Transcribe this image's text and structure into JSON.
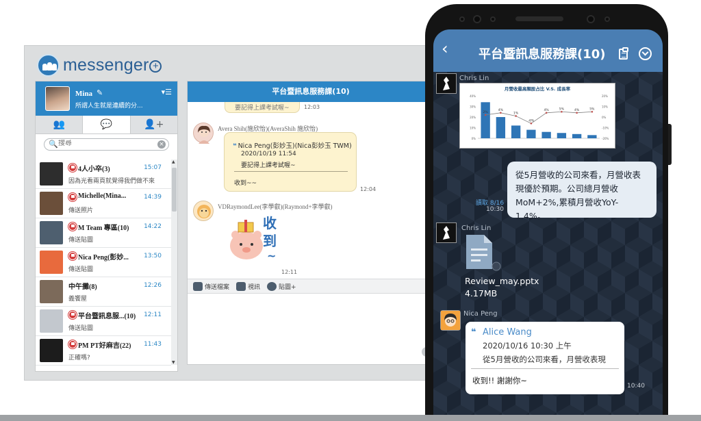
{
  "app": {
    "logo_text": "messenger",
    "logo_plus": "+"
  },
  "colors": {
    "brand_blue": "#2c86c6",
    "phone_header": "#4a7eb3",
    "bubble_yellow": "#fdf3cf",
    "unread_red": "#d33b3b"
  },
  "sidebar": {
    "profile": {
      "name": "Mina",
      "status": "所謂人生就是連續的分..."
    },
    "tabs": [
      {
        "icon": "contacts-icon"
      },
      {
        "icon": "chat-icon"
      },
      {
        "icon": "add-contact-icon"
      }
    ],
    "search": {
      "placeholder": "搜尋"
    },
    "conversations": [
      {
        "title": "4人小卒(3)",
        "time": "15:07",
        "preview": "因為光看兩頁就覺得我們做不來",
        "flag": true
      },
      {
        "title": "Michelle(Mina...",
        "time": "14:39",
        "preview": "傳送照片",
        "flag": true
      },
      {
        "title": "M Team 專區(10)",
        "time": "14:22",
        "preview": "傳送貼圖",
        "flag": true
      },
      {
        "title": "Nica Peng(彭妙...",
        "time": "13:50",
        "preview": "傳送貼圖",
        "flag": true
      },
      {
        "title": "中午攤(8)",
        "time": "12:26",
        "preview": "義饗屋",
        "flag": false
      },
      {
        "title": "平台暨訊息服...(10)",
        "time": "12:11",
        "preview": "傳送貼圖",
        "flag": true
      },
      {
        "title": "PM PT好麻吉(22)",
        "time": "11:43",
        "preview": "正確嗎?",
        "flag": true
      }
    ]
  },
  "chat": {
    "title": "平台暨訊息服務課(10)",
    "top_bubble_text": "要記得上課考試喔~",
    "top_time": "12:03",
    "msg1": {
      "sender": "Avera Shih(施欣怡)(AveraShih 施欣怡)",
      "quote_name": "Nica Peng(彭妙玉)(Nica彭妙玉 TWM)",
      "quote_date": "2020/10/19 11:54",
      "quote_text": "要記得上課考試喔~",
      "reply": "收到~~",
      "time": "12:04"
    },
    "msg2": {
      "sender": "VDRaymondLee(李學叡)(Raymond+李學叡)",
      "sticker_text": "收到~",
      "time": "12:11"
    },
    "tools": [
      {
        "label": "傳送檔案"
      },
      {
        "label": "視訊"
      },
      {
        "label": "貼圖+"
      }
    ]
  },
  "phone": {
    "title": "平台暨訊息服務課(10)",
    "msg1_sender": "Chris Lin",
    "chart_title": "月營收最高類股占比 V.S. 成長率",
    "outgoing_text": "從5月營收的公司來看，月營收表現優於預期。公司總月營收MoM+2%,累積月營收YoY-1.4%。",
    "read_label": "讀取 8/16",
    "read_time": "10:30",
    "msg2_sender": "Chris Lin",
    "file_name": "Review_may.pptx",
    "file_size": "4.17MB",
    "msg3_sender": "Nica Peng",
    "quote_name": "Alice Wang",
    "quote_date": "2020/10/16 10:30 上午",
    "quote_text": "從5月營收的公司來看，月營收表現",
    "reply": "收到!! 謝謝你~",
    "reply_time": "10:40"
  },
  "chart_data": {
    "type": "bar",
    "title": "月營收最高類股占比 V.S. 成長率",
    "categories": [
      "",
      "",
      "",
      "",
      "",
      "",
      "",
      ""
    ],
    "series": [
      {
        "values": [
          34,
          20,
          12,
          8,
          6,
          5,
          4,
          3
        ]
      },
      {
        "values": [
          2,
          4,
          1,
          -6,
          4,
          5,
          4,
          5
        ]
      }
    ],
    "left_ticks": [
      "40%",
      "30%",
      "20%",
      "10%",
      "0%"
    ],
    "right_ticks": [
      "20%",
      "10%",
      "0%",
      "-10%",
      "-20%"
    ],
    "data_labels": [
      "2%",
      "4%",
      "1%",
      "-6%",
      "4%",
      "5%",
      "4%",
      "5%"
    ]
  }
}
